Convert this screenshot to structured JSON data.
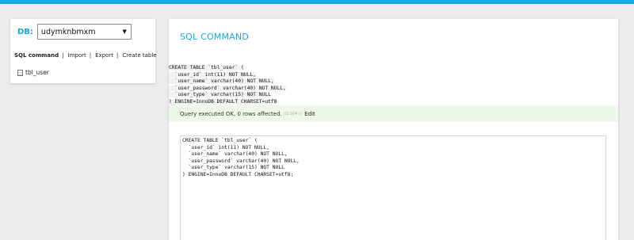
{
  "sidebar": {
    "db_label": "DB:",
    "db_selected": "udymknbmxm",
    "nav": [
      {
        "label": "SQL command",
        "active": true
      },
      {
        "label": "Import",
        "active": false
      },
      {
        "label": "Export",
        "active": false
      },
      {
        "label": "Create table",
        "active": false
      }
    ],
    "separator": "|",
    "tables": [
      "tbl_user"
    ]
  },
  "main": {
    "title": "SQL COMMAND",
    "executed_sql": [
      "CREATE TABLE `tbl_user` (",
      "  `user_id` int(11) NOT NULL,",
      "  `user_name` varchar(40) NOT NULL,",
      "  `user_password` varchar(40) NOT NULL,",
      "  `user_type` varchar(15) NOT NULL",
      ") ENGINE=InnoDB DEFAULT CHARSET=utf8"
    ],
    "result": {
      "message": "Query executed OK, 0 rows affected.",
      "time": "(0.024 s)",
      "edit_label": "Edit"
    },
    "editor_sql": [
      "CREATE TABLE `tbl_user` (",
      "  `user_id` int(11) NOT NULL,",
      "  `user_name` varchar(40) NOT NULL,",
      "  `user_password` varchar(40) NOT NULL,",
      "  `user_type` varchar(15) NOT NULL",
      ") ENGINE=InnoDB DEFAULT CHARSET=utf8;"
    ]
  },
  "colors": {
    "accent": "#1aa6e0",
    "success_bg": "#eef9ec"
  }
}
